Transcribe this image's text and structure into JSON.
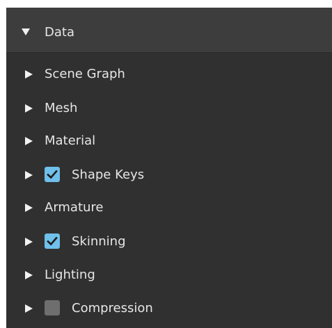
{
  "panel": {
    "header": {
      "title": "Data",
      "expanded": true,
      "icon": "triangle-down-icon"
    },
    "items": [
      {
        "label": "Scene Graph",
        "has_checkbox": false,
        "icon": "triangle-right-icon"
      },
      {
        "label": "Mesh",
        "has_checkbox": false,
        "icon": "triangle-right-icon"
      },
      {
        "label": "Material",
        "has_checkbox": false,
        "icon": "triangle-right-icon"
      },
      {
        "label": "Shape Keys",
        "has_checkbox": true,
        "checked": true,
        "icon": "triangle-right-icon"
      },
      {
        "label": "Armature",
        "has_checkbox": false,
        "icon": "triangle-right-icon"
      },
      {
        "label": "Skinning",
        "has_checkbox": true,
        "checked": true,
        "icon": "triangle-right-icon"
      },
      {
        "label": "Lighting",
        "has_checkbox": false,
        "icon": "triangle-right-icon"
      },
      {
        "label": "Compression",
        "has_checkbox": true,
        "checked": false,
        "icon": "triangle-right-icon"
      }
    ]
  },
  "colors": {
    "panel_bg": "#303030",
    "header_bg": "#3d3d3d",
    "text": "#e6e6e6",
    "checkbox_on": "#6fc0ea",
    "checkbox_off": "#6e6e6e"
  }
}
